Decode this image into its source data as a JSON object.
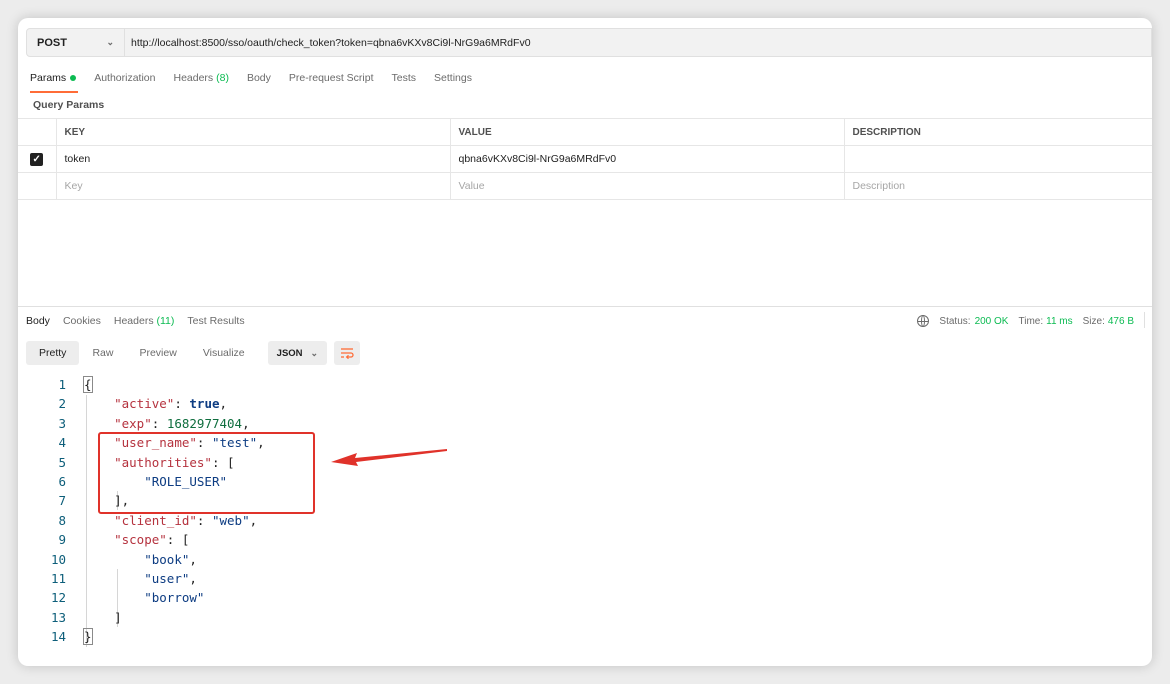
{
  "request": {
    "method": "POST",
    "url": "http://localhost:8500/sso/oauth/check_token?token=qbna6vKXv8Ci9l-NrG9a6MRdFv0"
  },
  "request_tabs": {
    "params": "Params",
    "authorization": "Authorization",
    "headers": "Headers",
    "headers_count": "(8)",
    "body": "Body",
    "prerequest": "Pre-request Script",
    "tests": "Tests",
    "settings": "Settings"
  },
  "query_params": {
    "title": "Query Params",
    "columns": {
      "key": "KEY",
      "value": "VALUE",
      "description": "DESCRIPTION"
    },
    "rows": [
      {
        "checked": "✓",
        "key": "token",
        "value": "qbna6vKXv8Ci9l-NrG9a6MRdFv0",
        "description": ""
      }
    ],
    "placeholder": {
      "key": "Key",
      "value": "Value",
      "description": "Description"
    }
  },
  "response_tabs": {
    "body": "Body",
    "cookies": "Cookies",
    "headers": "Headers",
    "headers_count": "(11)",
    "test_results": "Test Results"
  },
  "status": {
    "status_label": "Status:",
    "status_value": "200 OK",
    "time_label": "Time:",
    "time_value": "11 ms",
    "size_label": "Size:",
    "size_value": "476 B"
  },
  "view_modes": {
    "pretty": "Pretty",
    "raw": "Raw",
    "preview": "Preview",
    "visualize": "Visualize",
    "format": "JSON"
  },
  "code_lines": {
    "n1": "1",
    "n2": "2",
    "n3": "3",
    "n4": "4",
    "n5": "5",
    "n6": "6",
    "n7": "7",
    "n8": "8",
    "n9": "9",
    "n10": "10",
    "n11": "11",
    "n12": "12",
    "n13": "13",
    "n14": "14",
    "l1_brace": "{",
    "l2_key": "\"active\"",
    "l2_val": "true",
    "l3_key": "\"exp\"",
    "l3_val": "1682977404",
    "l4_key": "\"user_name\"",
    "l4_val": "\"test\"",
    "l5_key": "\"authorities\"",
    "l5_open": "[",
    "l6_val": "\"ROLE_USER\"",
    "l7_close": "],",
    "l8_key": "\"client_id\"",
    "l8_val": "\"web\"",
    "l9_key": "\"scope\"",
    "l9_open": "[",
    "l10_val": "\"book\"",
    "l11_val": "\"user\"",
    "l12_val": "\"borrow\"",
    "l13_close": "]",
    "l14_brace": "}"
  },
  "colors": {
    "accent": "#ff6c37",
    "success": "#0cbb52",
    "annotation": "#e0322a",
    "json_key": "#b5323e",
    "json_string": "#0d3c82",
    "json_number": "#0f6e3e"
  }
}
